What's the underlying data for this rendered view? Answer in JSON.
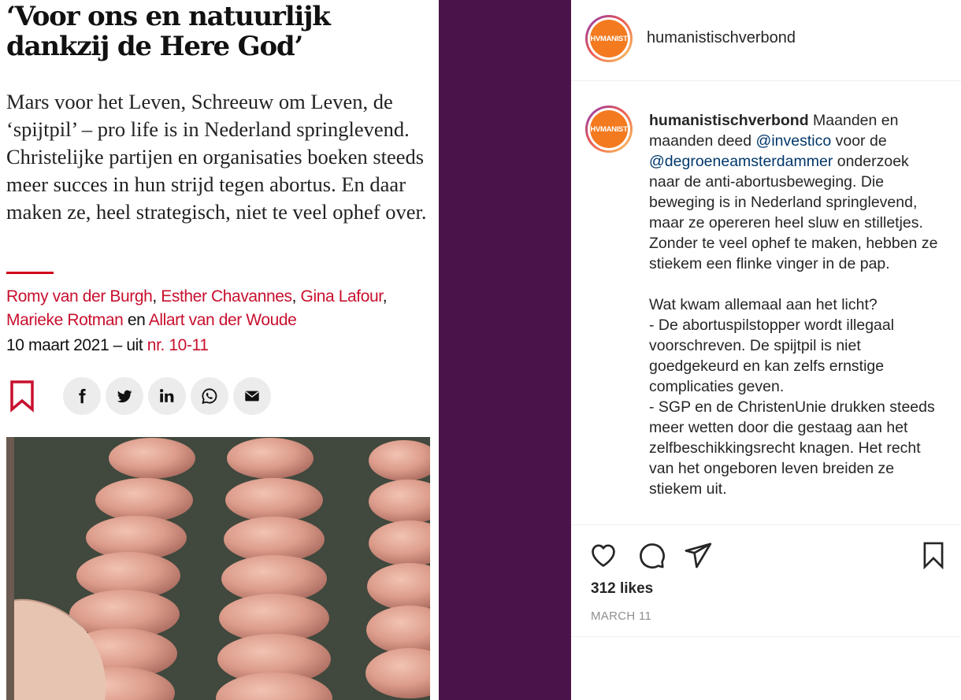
{
  "article": {
    "title": "‘Voor ons en natuurlijk dankzij de Here God’",
    "lead": "Mars voor het Leven, Schreeuw om Leven, de ‘spijtpil’ – pro life is in Nederland springlevend. Christelijke partijen en organisaties boeken steeds meer succes in hun strijd tegen abortus. En daar maken ze, heel strategisch, niet te veel ophef over.",
    "authors": {
      "a1": "Romy van der Burgh",
      "sep1": ", ",
      "a2": "Esther Chavannes",
      "sep2": ", ",
      "a3": "Gina Lafour",
      "sep3": ",",
      "a4": "Marieke Rotman",
      "sep4": " en ",
      "a5": "Allart van der Woude"
    },
    "date_text": "10 maart 2021 – uit ",
    "issue_link": "nr. 10-11",
    "share_icons": [
      "facebook-icon",
      "twitter-icon",
      "linkedin-icon",
      "whatsapp-icon",
      "mail-icon"
    ],
    "colors": {
      "accent_red": "#c8102e",
      "band_purple": "#4a1349"
    }
  },
  "instagram": {
    "username": "humanistischverbond",
    "avatar_text": "HVMANIST",
    "caption": {
      "user": "humanistischverbond",
      "p1": " Maanden en maanden deed ",
      "m1": "@investico",
      "p2": " voor de ",
      "m2": "@degroeneamsterdammer",
      "p3": " onderzoek naar de anti-abortusbeweging. Die beweging is in Nederland springlevend, maar ze opereren heel sluw en stilletjes. Zonder te veel ophef te maken, hebben ze stiekem een flinke vinger in de pap.\n\nWat kwam allemaal aan het licht?\n- De abortuspilstopper wordt illegaal voorschreven. De spijtpil is niet goedgekeurd en kan zelfs ernstige complicaties geven.\n- SGP en de ChristenUnie drukken steeds meer wetten door die gestaag aan het zelfbeschikkingsrecht knagen. Het recht van het ongeboren leven breiden ze stiekem uit."
    },
    "likes": "312 likes",
    "date": "MARCH 11"
  }
}
